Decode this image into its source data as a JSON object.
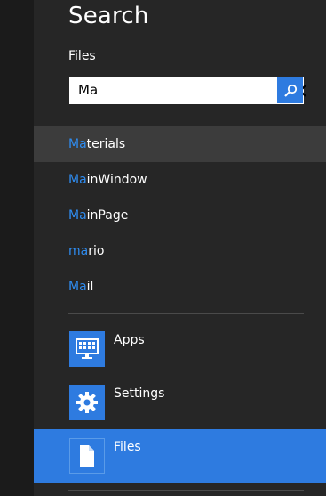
{
  "search": {
    "title": "Search",
    "scope": "Files",
    "query": "Ma"
  },
  "suggestions": [
    {
      "match": "Ma",
      "rest": "terials",
      "selected": true
    },
    {
      "match": "Ma",
      "rest": "inWindow",
      "selected": false
    },
    {
      "match": "Ma",
      "rest": "inPage",
      "selected": false
    },
    {
      "match": "ma",
      "rest": "rio",
      "selected": false
    },
    {
      "match": "Ma",
      "rest": "il",
      "selected": false
    }
  ],
  "scopes": [
    {
      "label": "Apps",
      "icon": "apps-icon",
      "selected": false
    },
    {
      "label": "Settings",
      "icon": "gear-icon",
      "selected": false
    },
    {
      "label": "Files",
      "icon": "file-icon",
      "selected": true
    }
  ],
  "colors": {
    "accent": "#2e7be0",
    "match_text": "#2f8cf0",
    "pane_bg": "#262626",
    "selected_suggestion_bg": "#3c3c3c"
  }
}
